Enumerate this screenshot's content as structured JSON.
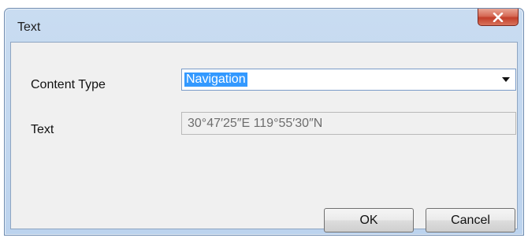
{
  "dialog": {
    "title": "Text",
    "close_icon": "close-icon"
  },
  "form": {
    "content_type_label": "Content Type",
    "content_type_value": "Navigation",
    "text_label": "Text",
    "text_value": "30°47′25″E 119°55′30″N"
  },
  "buttons": {
    "ok_label": "OK",
    "cancel_label": "Cancel"
  },
  "colors": {
    "selection": "#3399ff",
    "close_button": "#c23f2a",
    "window_frame": "#bcd3ee"
  }
}
